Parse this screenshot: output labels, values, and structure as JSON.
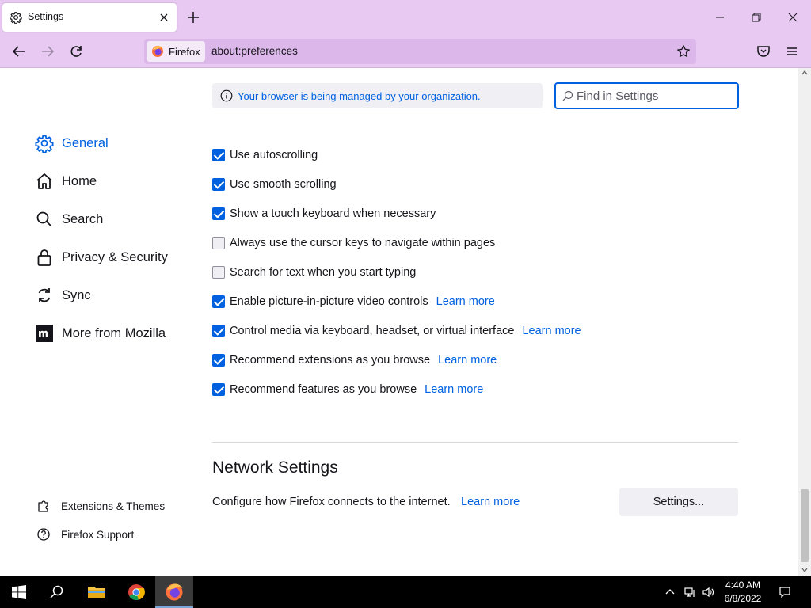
{
  "tab": {
    "title": "Settings"
  },
  "urlbar": {
    "identity_label": "Firefox",
    "url": "about:preferences"
  },
  "sidebar": {
    "items": [
      {
        "label": "General",
        "icon": "gear-icon",
        "active": true
      },
      {
        "label": "Home",
        "icon": "home-icon"
      },
      {
        "label": "Search",
        "icon": "search-icon"
      },
      {
        "label": "Privacy & Security",
        "icon": "lock-icon"
      },
      {
        "label": "Sync",
        "icon": "sync-icon"
      },
      {
        "label": "More from Mozilla",
        "icon": "mozilla-icon"
      }
    ],
    "footer": [
      {
        "label": "Extensions & Themes",
        "icon": "puzzle-icon"
      },
      {
        "label": "Firefox Support",
        "icon": "help-icon"
      }
    ]
  },
  "managed_banner": {
    "text": "Your browser is being managed by your organization."
  },
  "find": {
    "placeholder": "Find in Settings"
  },
  "browsing": {
    "options": [
      {
        "label": "Use autoscrolling",
        "checked": true
      },
      {
        "label": "Use smooth scrolling",
        "checked": true
      },
      {
        "label": "Show a touch keyboard when necessary",
        "checked": true
      },
      {
        "label": "Always use the cursor keys to navigate within pages",
        "checked": false
      },
      {
        "label": "Search for text when you start typing",
        "checked": false
      },
      {
        "label": "Enable picture-in-picture video controls",
        "checked": true,
        "learn_more": "Learn more"
      },
      {
        "label": "Control media via keyboard, headset, or virtual interface",
        "checked": true,
        "learn_more": "Learn more"
      },
      {
        "label": "Recommend extensions as you browse",
        "checked": true,
        "learn_more": "Learn more"
      },
      {
        "label": "Recommend features as you browse",
        "checked": true,
        "learn_more": "Learn more"
      }
    ]
  },
  "network": {
    "title": "Network Settings",
    "description": "Configure how Firefox connects to the internet.",
    "learn_more": "Learn more",
    "button": "Settings..."
  },
  "taskbar": {
    "time": "4:40 AM",
    "date": "6/8/2022"
  },
  "colors": {
    "accent": "#0061e0",
    "chrome": "#e8c9f2",
    "urlbar": "#dcb8ea"
  }
}
